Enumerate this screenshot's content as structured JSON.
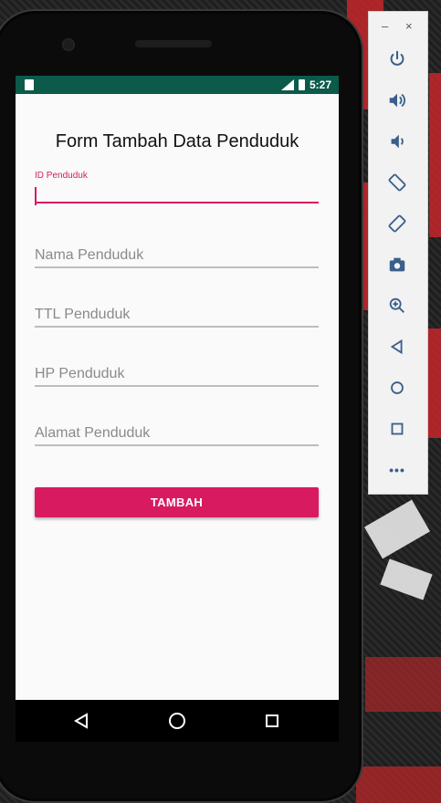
{
  "status_bar": {
    "time": "5:27"
  },
  "form": {
    "title": "Form Tambah Data Penduduk",
    "fields": [
      {
        "label": "ID Penduduk",
        "value": ""
      },
      {
        "placeholder": "Nama Penduduk"
      },
      {
        "placeholder": "TTL Penduduk"
      },
      {
        "placeholder": "HP Penduduk"
      },
      {
        "placeholder": "Alamat Penduduk"
      }
    ],
    "submit_label": "TAMBAH"
  },
  "emulator_toolbar": {
    "minimize_label": "–",
    "close_label": "×",
    "more_label": "•••"
  },
  "colors": {
    "accent": "#d81b60",
    "status_bar": "#0b5a4a",
    "screen_bg": "#fafafa"
  },
  "icons": [
    "power-icon",
    "volume-up-icon",
    "volume-down-icon",
    "rotate-left-icon",
    "rotate-right-icon",
    "camera-icon",
    "zoom-icon",
    "back-icon",
    "home-icon",
    "overview-icon",
    "more-icon"
  ]
}
